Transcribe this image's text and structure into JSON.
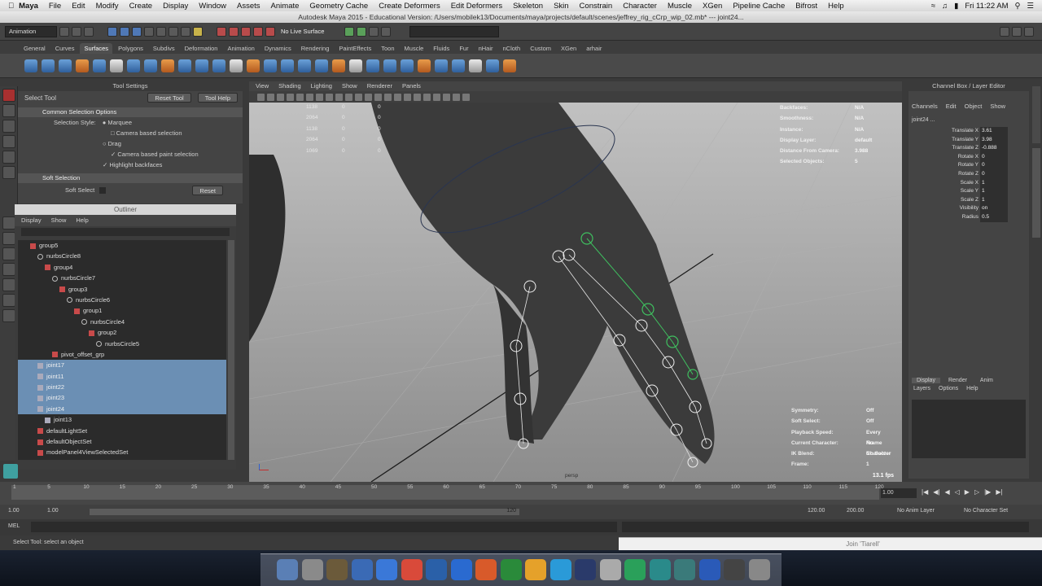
{
  "mac_menubar": {
    "app": "Maya",
    "items": [
      "File",
      "Edit",
      "Modify",
      "Create",
      "Display",
      "Window",
      "Assets",
      "Animate",
      "Geometry Cache",
      "Create Deformers",
      "Edit Deformers",
      "Skeleton",
      "Skin",
      "Constrain",
      "Character",
      "Muscle",
      "XGen",
      "Pipeline Cache",
      "Bifrost",
      "Help"
    ],
    "clock": "Fri 11:22 AM"
  },
  "window_title": "Autodesk Maya 2015 - Educational Version: /Users/mobilek13/Documents/maya/projects/default/scenes/jeffrey_rig_cCrp_wip_02.mb* --- joint24...",
  "status_line": {
    "mode": "Animation",
    "live_surface": "No Live Surface"
  },
  "shelf_tabs": [
    "General",
    "Curves",
    "Surfaces",
    "Polygons",
    "Subdivs",
    "Deformation",
    "Animation",
    "Dynamics",
    "Rendering",
    "PaintEffects",
    "Toon",
    "Muscle",
    "Fluids",
    "Fur",
    "nHair",
    "nCloth",
    "Custom",
    "XGen",
    "arhair"
  ],
  "active_shelf_tab": "Surfaces",
  "tool_settings": {
    "header": "Tool Settings",
    "tool_name": "Select Tool",
    "reset_label": "Reset Tool",
    "help_label": "Tool Help",
    "section_common": "Common Selection Options",
    "selection_style_label": "Selection Style:",
    "options": [
      "Marquee",
      "Camera based selection",
      "Drag",
      "Camera based paint selection",
      "Highlight backfaces"
    ],
    "section_soft": "Soft Selection",
    "soft_select_label": "Soft Select",
    "soft_reset": "Reset"
  },
  "outliner": {
    "title": "Outliner",
    "menu": [
      "Display",
      "Show",
      "Help"
    ],
    "items": [
      {
        "label": "group5",
        "type": "grp",
        "indent": 1,
        "hl": false
      },
      {
        "label": "nurbsCircle8",
        "type": "crv",
        "indent": 2,
        "hl": false
      },
      {
        "label": "group4",
        "type": "grp",
        "indent": 3,
        "hl": false
      },
      {
        "label": "nurbsCircle7",
        "type": "crv",
        "indent": 4,
        "hl": false
      },
      {
        "label": "group3",
        "type": "grp",
        "indent": 5,
        "hl": false
      },
      {
        "label": "nurbsCircle6",
        "type": "crv",
        "indent": 6,
        "hl": false
      },
      {
        "label": "group1",
        "type": "grp",
        "indent": 7,
        "hl": false
      },
      {
        "label": "nurbsCircle4",
        "type": "crv",
        "indent": 8,
        "hl": false
      },
      {
        "label": "group2",
        "type": "grp",
        "indent": 9,
        "hl": false
      },
      {
        "label": "nurbsCircle5",
        "type": "crv",
        "indent": 10,
        "hl": false
      },
      {
        "label": "pivot_offset_grp",
        "type": "grp",
        "indent": 4,
        "hl": false
      },
      {
        "label": "joint17",
        "type": "jnt",
        "indent": 2,
        "hl": true
      },
      {
        "label": "joint11",
        "type": "jnt",
        "indent": 2,
        "hl": true
      },
      {
        "label": "joint22",
        "type": "jnt",
        "indent": 2,
        "hl": true
      },
      {
        "label": "joint23",
        "type": "jnt",
        "indent": 2,
        "hl": true
      },
      {
        "label": "joint24",
        "type": "jnt",
        "indent": 2,
        "hl": true
      },
      {
        "label": "joint13",
        "type": "jnt",
        "indent": 3,
        "hl": false
      },
      {
        "label": "defaultLightSet",
        "type": "set",
        "indent": 2,
        "hl": false
      },
      {
        "label": "defaultObjectSet",
        "type": "set",
        "indent": 2,
        "hl": false
      },
      {
        "label": "modelPanel4ViewSelectedSet",
        "type": "set",
        "indent": 2,
        "hl": false
      }
    ]
  },
  "viewport": {
    "menu": [
      "View",
      "Shading",
      "Lighting",
      "Show",
      "Renderer",
      "Panels"
    ],
    "hud_stats": [
      [
        "1138",
        "0",
        "0"
      ],
      [
        "2064",
        "0",
        "0"
      ],
      [
        "1138",
        "0",
        "0"
      ],
      [
        "2064",
        "0",
        "0"
      ],
      [
        "1069",
        "0",
        "0"
      ]
    ],
    "hud_right": [
      [
        "Backfaces:",
        "N/A"
      ],
      [
        "Smoothness:",
        "N/A"
      ],
      [
        "Instance:",
        "N/A"
      ],
      [
        "Display Layer:",
        "default"
      ],
      [
        "Distance From Camera:",
        "3.988"
      ],
      [
        "Selected Objects:",
        "5"
      ]
    ],
    "hud_bottom": [
      [
        "Symmetry:",
        "Off"
      ],
      [
        "Soft Select:",
        "Off"
      ],
      [
        "Playback Speed:",
        "Every Frame"
      ],
      [
        "Current Character:",
        "No Character"
      ],
      [
        "IK Blend:",
        "No Solver"
      ],
      [
        "Frame:",
        "1"
      ]
    ],
    "camera": "persp",
    "fps": "13.1 fps"
  },
  "channel_box": {
    "title": "Channel Box / Layer Editor",
    "menu": [
      "Channels",
      "Edit",
      "Object",
      "Show"
    ],
    "object": "joint24 ...",
    "attrs": [
      [
        "Translate X",
        "3.61"
      ],
      [
        "Translate Y",
        "3.98"
      ],
      [
        "Translate Z",
        "-0.888"
      ],
      [
        "Rotate X",
        "0"
      ],
      [
        "Rotate Y",
        "0"
      ],
      [
        "Rotate Z",
        "0"
      ],
      [
        "Scale X",
        "1"
      ],
      [
        "Scale Y",
        "1"
      ],
      [
        "Scale Z",
        "1"
      ],
      [
        "Visibility",
        "on"
      ],
      [
        "Radius",
        "0.5"
      ]
    ]
  },
  "layer_editor": {
    "tabs": [
      "Display",
      "Render",
      "Anim"
    ],
    "menu": [
      "Layers",
      "Options",
      "Help"
    ]
  },
  "timeline": {
    "ticks": [
      "1",
      "5",
      "10",
      "15",
      "20",
      "25",
      "30",
      "35",
      "40",
      "45",
      "50",
      "55",
      "60",
      "65",
      "70",
      "75",
      "80",
      "85",
      "90",
      "95",
      "100",
      "105",
      "110",
      "115",
      "120"
    ],
    "current": "1.00"
  },
  "range": {
    "start": "1.00",
    "playstart": "1.00",
    "scroll_label": "120",
    "playend": "120.00",
    "end": "200.00",
    "anim_layer": "No Anim Layer",
    "character": "No Character Set"
  },
  "command_line": {
    "label": "MEL"
  },
  "help_line": "Select Tool: select an object",
  "popup_title": "Join 'Tiarell'",
  "colors": {
    "selection_highlight": "#6b8fb4",
    "viewport_bg": "#9a9a9a",
    "joint_selected": "#3fbf5f"
  }
}
